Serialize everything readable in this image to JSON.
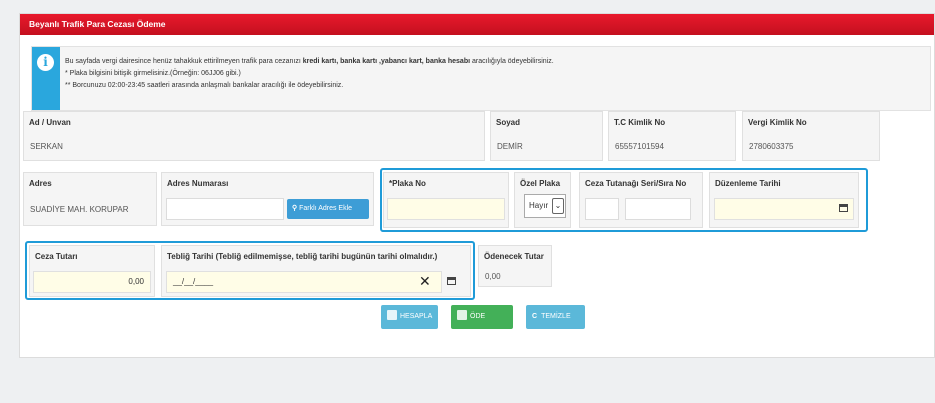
{
  "title": "Beyanlı Trafik Para Cezası Ödeme",
  "info": {
    "icon": "info-icon",
    "line1_a": "Bu sayfada vergi dairesince henüz tahakkuk ettirilmeyen trafik para cezanızı ",
    "line1_b": "kredi kartı, banka kartı ,yabancı kart, banka hesabı",
    "line1_c": " aracılığıyla ödeyebilirsiniz.",
    "line2": "* Plaka bilgisini bitişik girmelisiniz.(Örneğin: 06JJ06 gibi.)",
    "line3": "** Borcunuzu 02:00-23:45 saatleri arasında anlaşmalı bankalar aracılığı ile ödeyebilirsiniz."
  },
  "row1": {
    "ad_label": "Ad / Unvan",
    "ad_value": "SERKAN",
    "soyad_label": "Soyad",
    "soyad_value": "DEMİR",
    "tc_label": "T.C Kimlik No",
    "tc_value": "65557101594",
    "vergi_label": "Vergi Kimlik No",
    "vergi_value": "2780603375"
  },
  "row2": {
    "adres_label": "Adres",
    "adres_value": "SUADİYE MAH. KORUPAR",
    "adresno_label": "Adres Numarası",
    "farkli_adres_button": "Farklı Adres Ekle",
    "plaka_label": "*Plaka No",
    "ozel_plaka_label": "Özel Plaka",
    "ozel_plaka_value": "Hayır",
    "tutanak_label": "Ceza Tutanağı Seri/Sıra No",
    "duzenleme_label": "Düzenleme Tarihi"
  },
  "row3": {
    "ceza_label": "Ceza Tutarı",
    "ceza_value": "0,00",
    "teblig_label": "Tebliğ Tarihi (Tebliğ edilmemişse, tebliğ tarihi bugünün tarihi olmalıdır.)",
    "teblig_value": "__/__/____",
    "clear_glyph": "✕",
    "odenecek_label": "Ödenecek Tutar",
    "odenecek_value": "0,00"
  },
  "buttons": {
    "hesapla": "HESAPLA",
    "ode": "ÖDE",
    "temizle": "TEMİZLE"
  },
  "colors": {
    "titlebar": "#d4131f",
    "info_accent": "#2aa7dd",
    "highlight": "#1f9bd8",
    "ode_button": "#43b058"
  }
}
